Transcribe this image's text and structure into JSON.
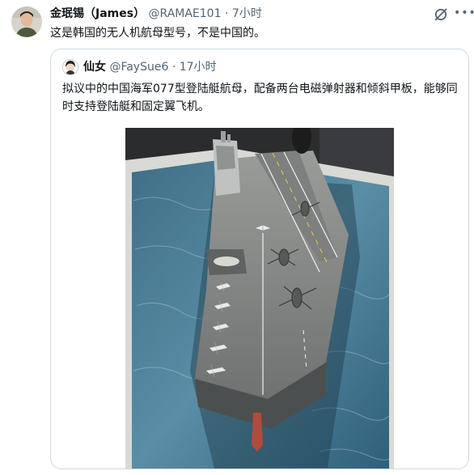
{
  "tweet": {
    "author_name": "金珉锡（James）",
    "handle": "@RAMAE101",
    "time": "· 7小时",
    "text": "这是韩国的无人机航母型号，不是中国的。"
  },
  "quoted_tweet": {
    "author_name": "仙女",
    "handle": "@FaySue6",
    "time": "· 17小时",
    "text": "拟议中的中国海军077型登陆艇航母，配备两台电磁弹射器和倾斜甲板，能够同时支持登陆艇和固定翼飞机。"
  },
  "icons": {
    "grok": "grok-icon",
    "more": "more-options-icon"
  },
  "colors": {
    "text_primary": "#0f1419",
    "text_secondary": "#536471",
    "border": "#cfd9de"
  }
}
